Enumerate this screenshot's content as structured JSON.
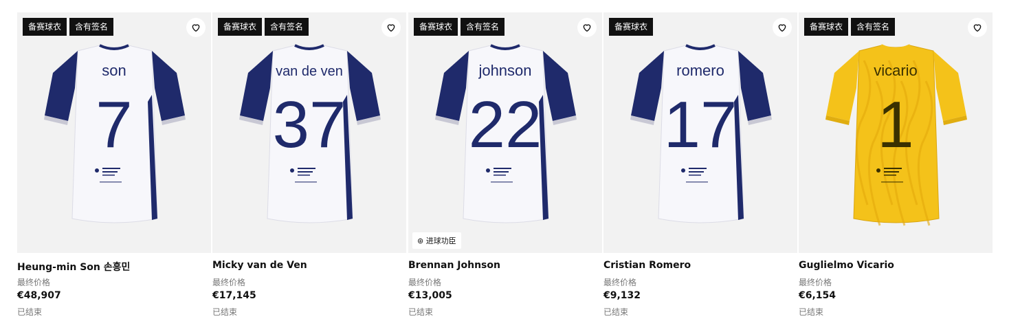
{
  "products": [
    {
      "badges": [
        "备赛球衣",
        "含有签名"
      ],
      "jersey_name": "son",
      "jersey_number": "7",
      "variant": "home",
      "name": "Heung-min Son 손흥민",
      "price_label": "最终价格",
      "price": "€48,907",
      "status": "已结束",
      "overlay": ""
    },
    {
      "badges": [
        "备赛球衣",
        "含有签名"
      ],
      "jersey_name": "van de ven",
      "jersey_number": "37",
      "variant": "home",
      "name": "Micky van de Ven",
      "price_label": "最终价格",
      "price": "€17,145",
      "status": "已结束",
      "overlay": ""
    },
    {
      "badges": [
        "备赛球衣",
        "含有签名"
      ],
      "jersey_name": "johnson",
      "jersey_number": "22",
      "variant": "home",
      "name": "Brennan Johnson",
      "price_label": "最终价格",
      "price": "€13,005",
      "status": "已结束",
      "overlay": "⊛ 进球功臣"
    },
    {
      "badges": [
        "备赛球衣"
      ],
      "jersey_name": "romero",
      "jersey_number": "17",
      "variant": "home",
      "name": "Cristian Romero",
      "price_label": "最终价格",
      "price": "€9,132",
      "status": "已结束",
      "overlay": ""
    },
    {
      "badges": [
        "备赛球衣",
        "含有签名"
      ],
      "jersey_name": "vicario",
      "jersey_number": "1",
      "variant": "goalkeeper",
      "name": "Guglielmo Vicario",
      "price_label": "最终价格",
      "price": "€6,154",
      "status": "已结束",
      "overlay": ""
    }
  ],
  "colors": {
    "home_body": "#f7f7fb",
    "home_sleeve": "#1f2a6b",
    "home_text": "#1f2a6b",
    "gk_body": "#f4c21a",
    "gk_text": "#3a3000",
    "badge_bg": "#111111"
  },
  "icons": {
    "favorite": "heart-outline-icon"
  }
}
